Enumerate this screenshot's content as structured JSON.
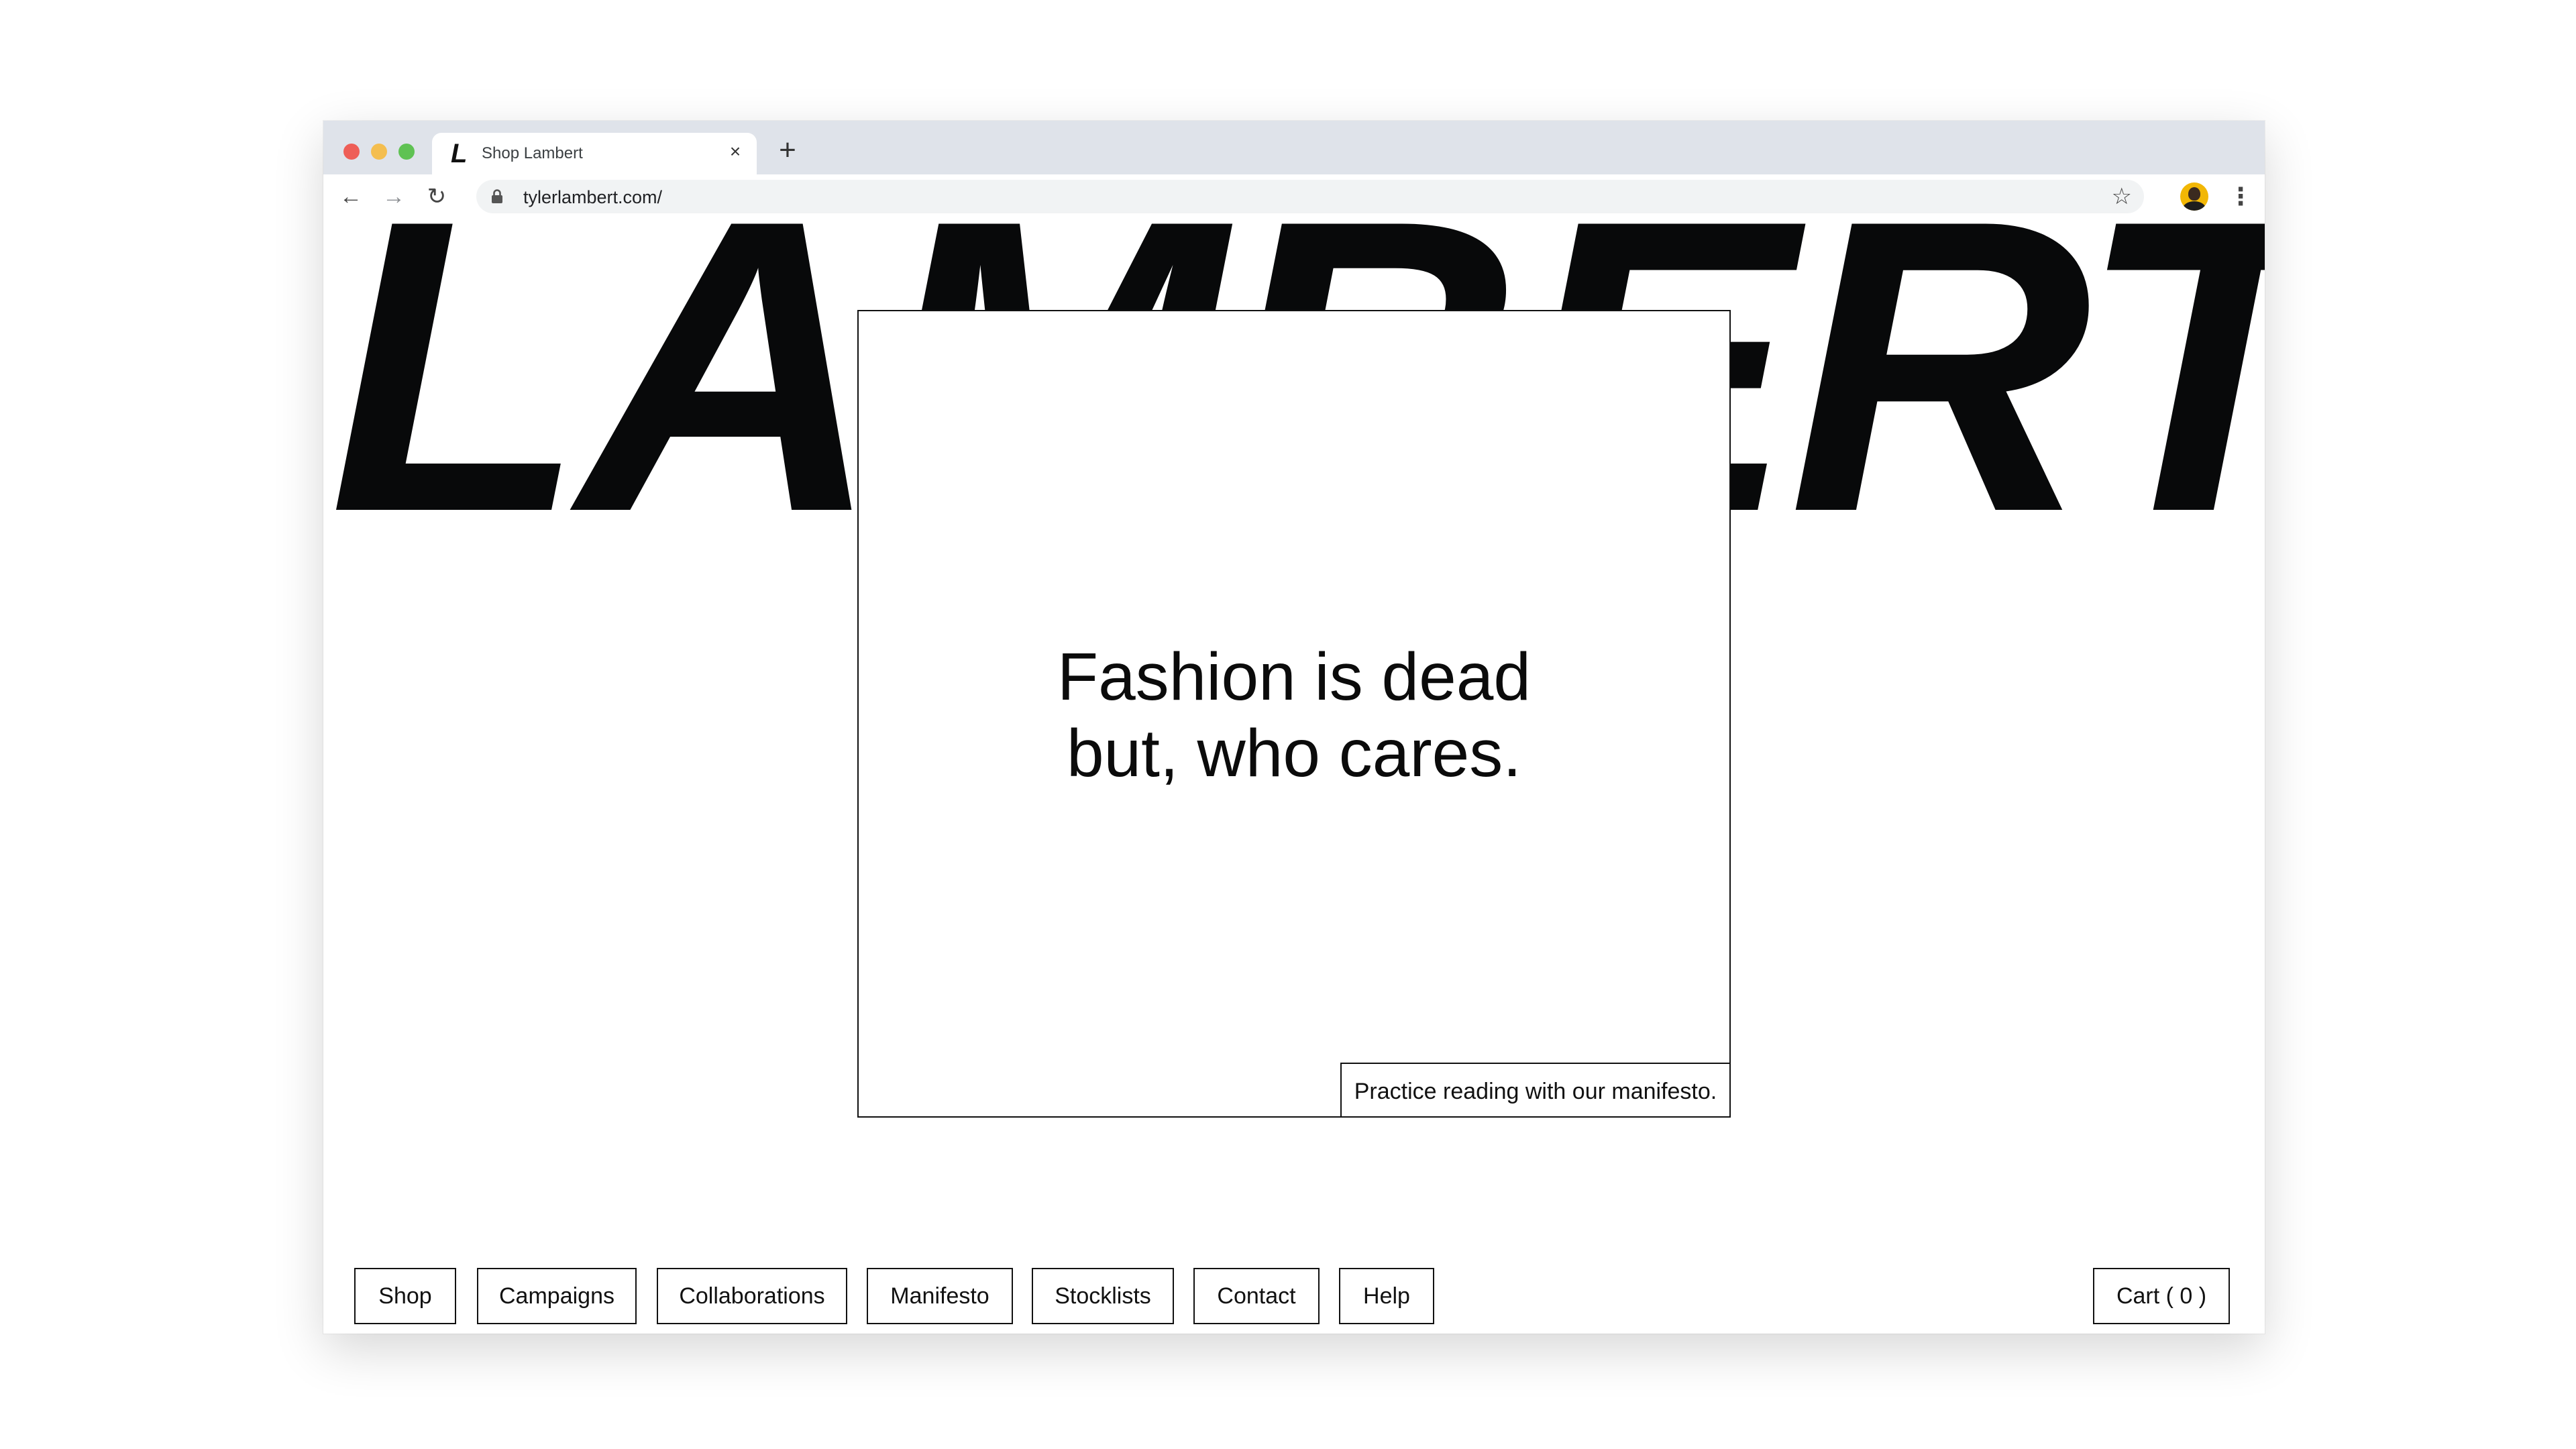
{
  "browser": {
    "tab": {
      "favicon": "L",
      "title": "Shop Lambert",
      "close_glyph": "×"
    },
    "new_tab_glyph": "+",
    "toolbar": {
      "back_glyph": "←",
      "forward_glyph": "→",
      "reload_glyph": "↻",
      "url": "tylerlambert.com/",
      "star_glyph": "☆",
      "menu_glyph": "⋮"
    }
  },
  "page": {
    "brand": "LAMBERT",
    "hero": {
      "headline": "Fashion is dead\n but, who cares.",
      "manifesto_link": "Practice reading with our manifesto."
    },
    "nav": [
      {
        "label": "Shop"
      },
      {
        "label": "Campaigns"
      },
      {
        "label": "Collaborations"
      },
      {
        "label": "Manifesto"
      },
      {
        "label": "Stocklists"
      },
      {
        "label": "Contact"
      },
      {
        "label": "Help"
      }
    ],
    "cart_label": "Cart ( 0 )"
  },
  "icons": {
    "lock": "lock-icon",
    "avatar": "user-avatar"
  },
  "colors": {
    "brand_text": "#08090a",
    "tabstrip": "#dfe3ea",
    "close_dot": "#ee5e57",
    "minimize_dot": "#f4be4f",
    "zoom_dot": "#5fc253"
  }
}
